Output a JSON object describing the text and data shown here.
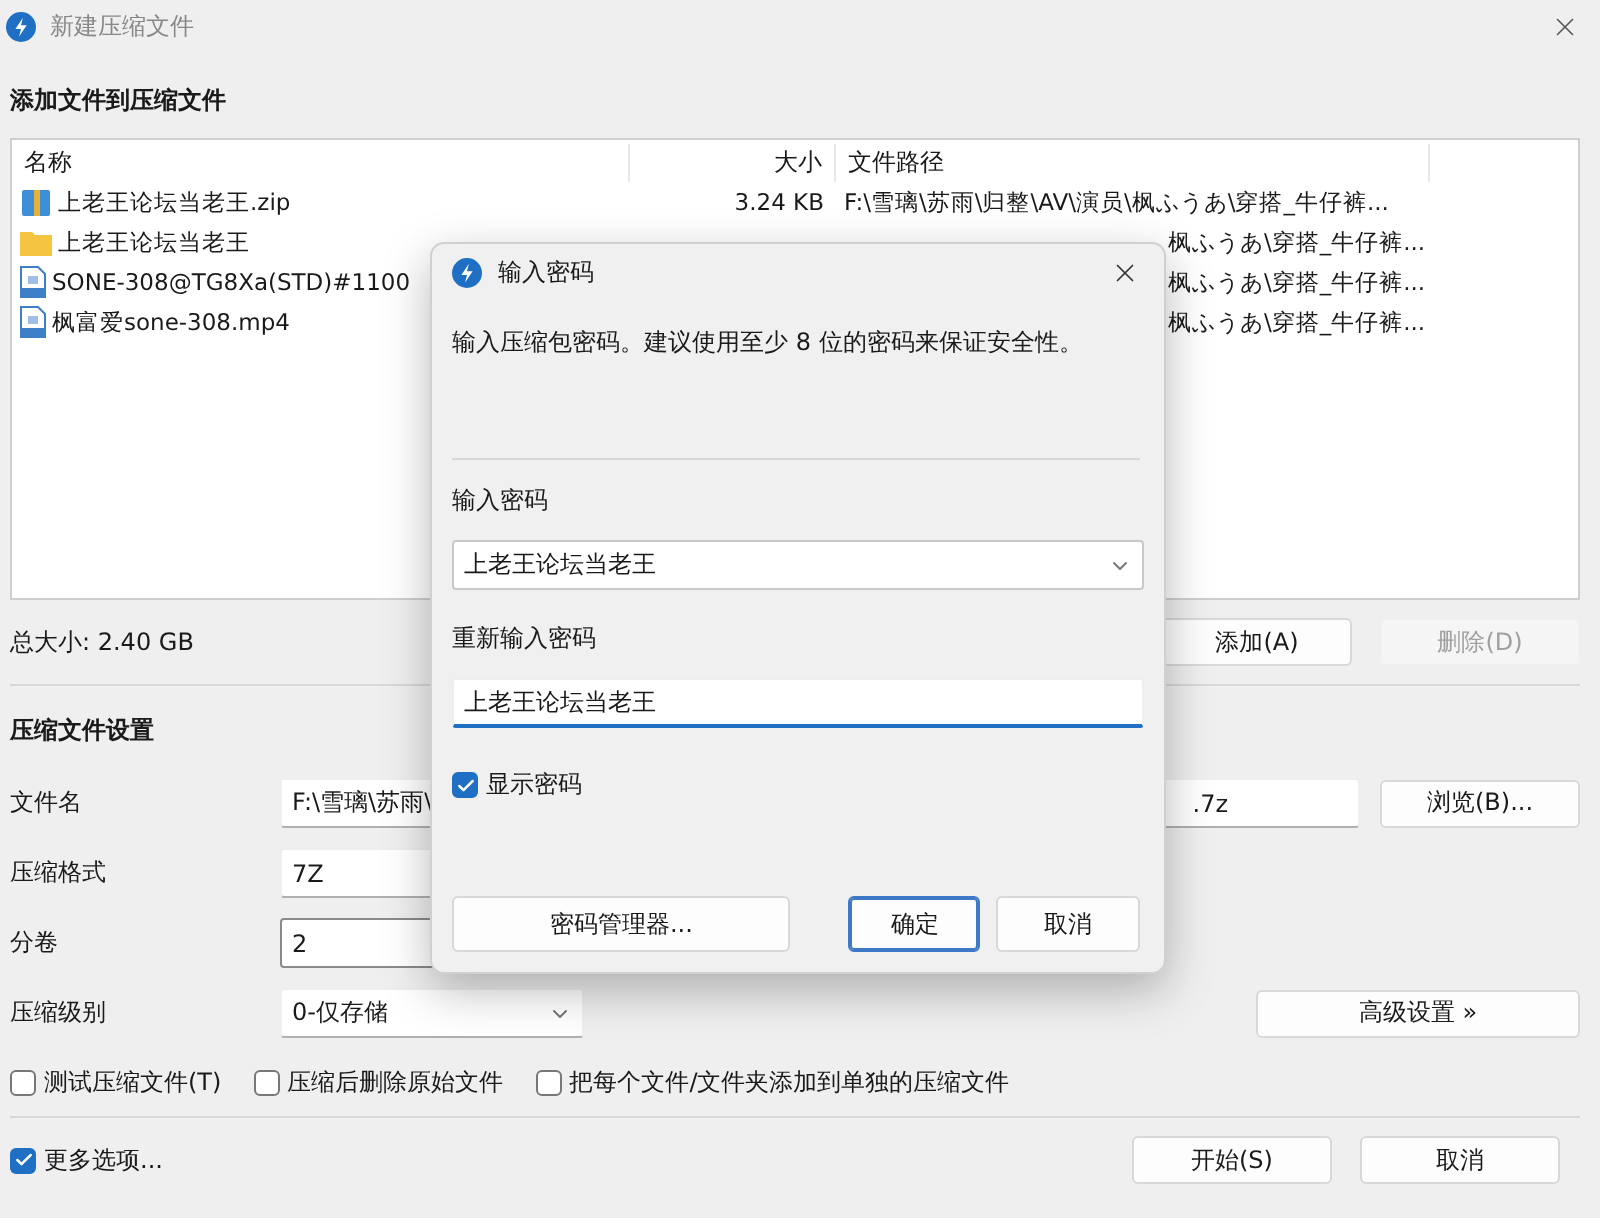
{
  "window": {
    "title": "新建压缩文件"
  },
  "files_section": {
    "title": "添加文件到压缩文件",
    "columns": [
      "名称",
      "大小",
      "文件路径"
    ],
    "rows": [
      {
        "kind": "zip",
        "name": "上老王论坛当老王.zip",
        "size": "3.24 KB",
        "path": "F:\\雪璃\\苏雨\\归整\\AV\\演员\\枫ふうあ\\穿搭_牛仔裤..."
      },
      {
        "kind": "folder",
        "name": "上老王论坛当老王",
        "path": "枫ふうあ\\穿搭_牛仔裤..."
      },
      {
        "kind": "document",
        "name": "SONE-308@TG8Xa(STD)#1100",
        "path": "枫ふうあ\\穿搭_牛仔裤..."
      },
      {
        "kind": "document",
        "name": "枫富爱sone-308.mp4",
        "path": "枫ふうあ\\穿搭_牛仔裤..."
      }
    ]
  },
  "total_size": "总大小: 2.40 GB",
  "list_buttons": [
    {
      "label": "添加(A)",
      "disabled": false
    },
    {
      "label": "删除(D)",
      "disabled": true
    }
  ],
  "settings": {
    "title": "压缩文件设置",
    "filename": {
      "label": "文件名",
      "value_start": "F:\\雪璃\\苏雨\\",
      "value_end": ".7z"
    },
    "browse_button": "浏览(B)...",
    "format": {
      "label": "压缩格式",
      "value": "7Z"
    },
    "volume": {
      "label": "分卷",
      "value": "2"
    },
    "level": {
      "label": "压缩级别",
      "value": "0-仅存储"
    },
    "advanced_button": "高级设置 »",
    "options": [
      {
        "label": "测试压缩文件(T)",
        "checked": false
      },
      {
        "label": "压缩后删除原始文件",
        "checked": false
      },
      {
        "label": "把每个文件/文件夹添加到单独的压缩文件",
        "checked": false
      }
    ]
  },
  "more_options": {
    "label": "更多选项...",
    "checked": true
  },
  "footer_buttons": [
    "开始(S)",
    "取消"
  ],
  "dialog": {
    "title": "输入密码",
    "description": "输入压缩包密码。建议使用至少 8 位的密码来保证安全性。",
    "password_label": "输入密码",
    "password": "上老王论坛当老王",
    "confirm_label": "重新输入密码",
    "confirm": "上老王论坛当老王",
    "show_password": {
      "label": "显示密码",
      "checked": true
    },
    "manager_button": "密码管理器...",
    "buttons": [
      {
        "label": "确定",
        "focused": true
      },
      {
        "label": "取消",
        "focused": false
      }
    ]
  }
}
